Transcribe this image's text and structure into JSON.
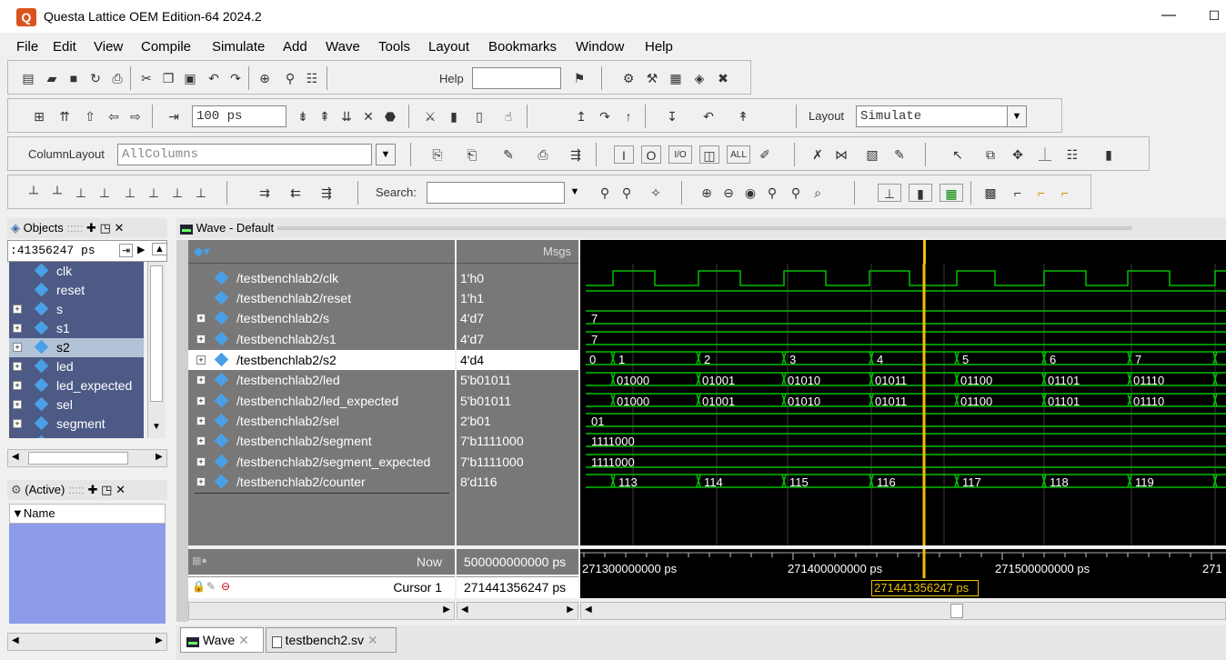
{
  "window": {
    "title": "Questa Lattice OEM Edition-64 2024.2",
    "minimize": "—",
    "maximize": "☐"
  },
  "menu": [
    "File",
    "Edit",
    "View",
    "Compile",
    "Simulate",
    "Add",
    "Wave",
    "Tools",
    "Layout",
    "Bookmarks",
    "Window",
    "Help"
  ],
  "toolbar": {
    "help_label": "Help",
    "time_value": "100 ps",
    "layout_label": "Layout",
    "layout_value": "Simulate",
    "column_layout_label": "ColumnLayout",
    "column_layout_value": "AllColumns",
    "search_label": "Search:"
  },
  "objects_panel": {
    "title": "Objects",
    "time_field": ":41356247 ps",
    "items": [
      "clk",
      "reset",
      "s",
      "s1",
      "s2",
      "led",
      "led_expected",
      "sel",
      "segment",
      "segment_expected"
    ]
  },
  "active_panel": {
    "title": "(Active)",
    "column": "Name"
  },
  "wave_window": {
    "title": "Wave - Default",
    "msgs_header": "Msgs",
    "now_label": "Now",
    "now_value": "500000000000 ps",
    "cursor_label": "Cursor 1",
    "cursor_value": "271441356247 ps",
    "cursor_tag": "271441356247 ps"
  },
  "signals": [
    {
      "name": "/testbenchlab2/clk",
      "value": "1'h0",
      "expandable": false
    },
    {
      "name": "/testbenchlab2/reset",
      "value": "1'h1",
      "expandable": false
    },
    {
      "name": "/testbenchlab2/s",
      "value": "4'd7",
      "expandable": true
    },
    {
      "name": "/testbenchlab2/s1",
      "value": "4'd7",
      "expandable": true
    },
    {
      "name": "/testbenchlab2/s2",
      "value": "4'd4",
      "expandable": true
    },
    {
      "name": "/testbenchlab2/led",
      "value": "5'b01011",
      "expandable": true
    },
    {
      "name": "/testbenchlab2/led_expected",
      "value": "5'b01011",
      "expandable": true
    },
    {
      "name": "/testbenchlab2/sel",
      "value": "2'b01",
      "expandable": true
    },
    {
      "name": "/testbenchlab2/segment",
      "value": "7'b1111000",
      "expandable": true
    },
    {
      "name": "/testbenchlab2/segment_expected",
      "value": "7'b1111000",
      "expandable": true
    },
    {
      "name": "/testbenchlab2/counter",
      "value": "8'd116",
      "expandable": true
    }
  ],
  "wave_labels": {
    "s": "7",
    "s1": "7",
    "sel": "01",
    "segment": "1111000",
    "segment_expected": "1111000",
    "s2": [
      "0",
      "1",
      "2",
      "3",
      "4",
      "5",
      "6",
      "7"
    ],
    "led": [
      "01000",
      "01001",
      "01010",
      "01011",
      "01100",
      "01101",
      "01110"
    ],
    "led_expected": [
      "01000",
      "01001",
      "01010",
      "01011",
      "01100",
      "01101",
      "01110"
    ],
    "counter": [
      "113",
      "114",
      "115",
      "116",
      "117",
      "118",
      "119"
    ]
  },
  "timeline": [
    "271300000000 ps",
    "271400000000 ps",
    "271500000000 ps",
    "271"
  ],
  "tabs": [
    "Wave",
    "testbench2.sv"
  ],
  "colors": {
    "wave_green": "#00c000",
    "cursor": "#f0c000",
    "signal_bg": "#787878",
    "objects_bg": "#4e5a86"
  }
}
